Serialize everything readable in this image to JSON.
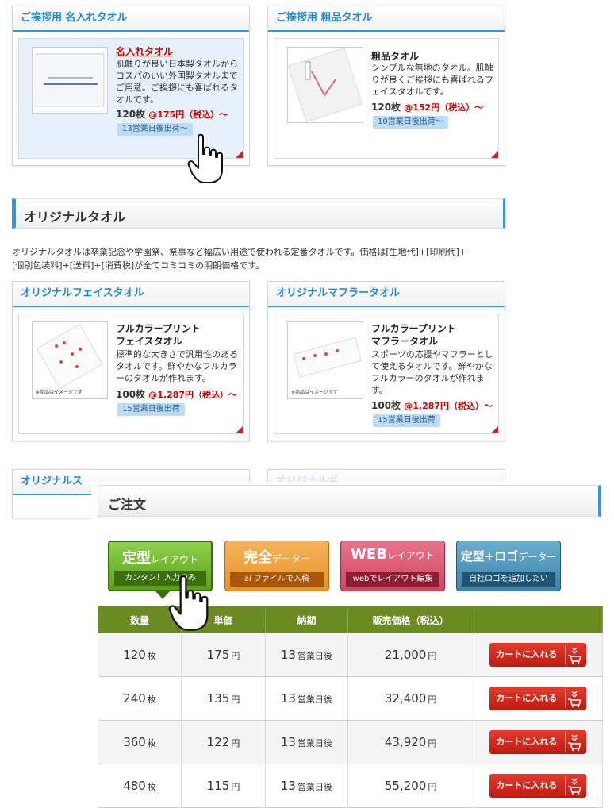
{
  "cards_top": [
    {
      "header": "ご挨拶用 名入れタオル",
      "title": "名入れタオル",
      "desc": "肌触りが良い日本製タオルからコスパのいい外国製タオルまでご用意。ご挨拶にも喜ばれるタオルです。",
      "qty": "120枚",
      "price": "@175円（税込）～",
      "ship": "13営業日後出荷～"
    },
    {
      "header": "ご挨拶用 粗品タオル",
      "title": "粗品タオル",
      "desc": "シンプルな無地のタオル。肌触りが良くご挨拶にも喜ばれるフェイスタオルです。",
      "qty": "120枚",
      "price": "@152円（税込）～",
      "ship": "10営業日後出荷～"
    }
  ],
  "section_original": {
    "title": "オリジナルタオル",
    "desc_line1": "オリジナルタオルは卒業記念や学園祭、祭事など幅広い用途で使われる定番タオルです。価格は[生地代]+[印刷代]+",
    "desc_line2": "[個別包装料]+[送料]+[消費税]が全てコミコミの明朗価格です。"
  },
  "cards_mid": [
    {
      "header": "オリジナルフェイスタオル",
      "title1": "フルカラープリント",
      "title2": "フェイスタオル",
      "desc": "標準的な大きさで汎用性のあるタオルです。鮮やかなフルカラーのタオルが作れます。",
      "qty": "100枚",
      "price": "@1,287円（税込）～",
      "ship": "15営業日後出荷",
      "note": "※商品はイメージです"
    },
    {
      "header": "オリジナルマフラータオル",
      "title1": "フルカラープリント",
      "title2": "マフラータオル",
      "desc": "スポーツの応援やマフラーとして使えるタオルです。鮮やかなフルカラーのタオルが作れます。",
      "qty": "100枚",
      "price": "@1,287円（税込）～",
      "ship": "15営業日後出荷",
      "note": "※商品はイメージです"
    }
  ],
  "cards_bottom_partial": {
    "left": "オリジナルス",
    "right": "オリジナルギ"
  },
  "order": {
    "title": "ご注文",
    "layout_buttons": [
      {
        "big": "定型",
        "small": "レイアウト",
        "sub": "カンタン！入力のみ",
        "color": "#5aa21b",
        "sub_color": "#3c6e0f"
      },
      {
        "big": "完全",
        "small": "データー",
        "sub": "ai ファイルで入稿",
        "color": "#e8932a",
        "sub_color": "#a8560c"
      },
      {
        "big": "WEB",
        "small": "レイアウト",
        "sub": "webでレイアウト編集",
        "color": "#d0475f",
        "sub_color": "#8c1e33"
      },
      {
        "big": "定型+ロゴ",
        "small": "データー",
        "sub": "自社ロゴを追加したい",
        "color": "#3b83a8",
        "sub_color": "#1f5573"
      }
    ],
    "columns": [
      "数量",
      "単価",
      "納期",
      "販売価格（税込）",
      ""
    ],
    "cart_label": "カートに入れる",
    "rows": [
      {
        "qty": "120",
        "qty_unit": "枚",
        "unit_price": "175",
        "yen": "円",
        "days": "13",
        "days_unit": "営業日後",
        "total": "21,000",
        "total_unit": "円"
      },
      {
        "qty": "240",
        "qty_unit": "枚",
        "unit_price": "135",
        "yen": "円",
        "days": "13",
        "days_unit": "営業日後",
        "total": "32,400",
        "total_unit": "円"
      },
      {
        "qty": "360",
        "qty_unit": "枚",
        "unit_price": "122",
        "yen": "円",
        "days": "13",
        "days_unit": "営業日後",
        "total": "43,920",
        "total_unit": "円"
      },
      {
        "qty": "480",
        "qty_unit": "枚",
        "unit_price": "115",
        "yen": "円",
        "days": "13",
        "days_unit": "営業日後",
        "total": "55,200",
        "total_unit": "円"
      }
    ]
  }
}
